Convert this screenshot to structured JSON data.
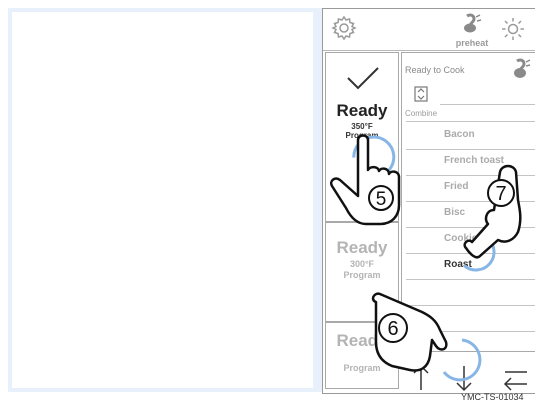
{
  "topbar": {
    "gear_icon": "gear-icon",
    "preheat_label": "preheat",
    "brightness_icon": "brightness-icon"
  },
  "tiles": [
    {
      "title": "Ready",
      "temp": "350°F",
      "mode": "Program",
      "selected": true
    },
    {
      "title": "Ready",
      "temp": "300°F",
      "mode": "Program"
    },
    {
      "title": "Ready",
      "temp": "",
      "mode": "Program"
    }
  ],
  "list": {
    "heading": "Ready to Cook",
    "combine_label": "Combine",
    "items": [
      "Bacon",
      "French toast",
      "Fried",
      "Bisc",
      "Cookie",
      "Roast"
    ],
    "selected_item": "Roast"
  },
  "nav": {
    "up_icon": "arrow-up-icon",
    "down_icon": "arrow-down-icon",
    "back_icon": "back-icon"
  },
  "callouts": [
    "5",
    "6",
    "7"
  ],
  "figure_id": "YMC-TS-01034",
  "colors": {
    "accent_ring": "#86b5e6",
    "background": "#e8f1fb"
  }
}
